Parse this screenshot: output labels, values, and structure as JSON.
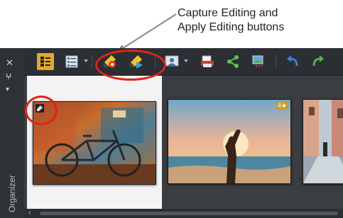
{
  "callout": {
    "line1": "Capture Editing and",
    "line2": "Apply Editing buttons"
  },
  "sidebar": {
    "close_glyph": "✕",
    "pin_glyph": "ⵖ",
    "menu_glyph": "▾",
    "label": "Organizer"
  },
  "toolbar": {
    "buttons": [
      {
        "name": "thumbnail-view-icon"
      },
      {
        "name": "details-view-icon"
      },
      {
        "name": "capture-editing-icon"
      },
      {
        "name": "apply-editing-icon"
      },
      {
        "name": "preview-icon"
      },
      {
        "name": "print-icon"
      },
      {
        "name": "share-icon"
      },
      {
        "name": "slideshow-icon"
      },
      {
        "name": "rotate-left-icon"
      },
      {
        "name": "rotate-right-icon"
      }
    ]
  },
  "thumbnails": [
    {
      "name": "bicycle-photo",
      "edited": true,
      "rating_badge": ""
    },
    {
      "name": "beach-silhouette-photo",
      "edited": false,
      "rating_badge": "4★"
    },
    {
      "name": "street-photo",
      "edited": false,
      "rating_badge": ""
    }
  ],
  "scrollbar": {
    "left_arrow": "‹"
  },
  "colors": {
    "accent_highlight": "#e02418",
    "toolbar_bg": "#2b2e32",
    "panel_bg": "#3a3d42"
  }
}
